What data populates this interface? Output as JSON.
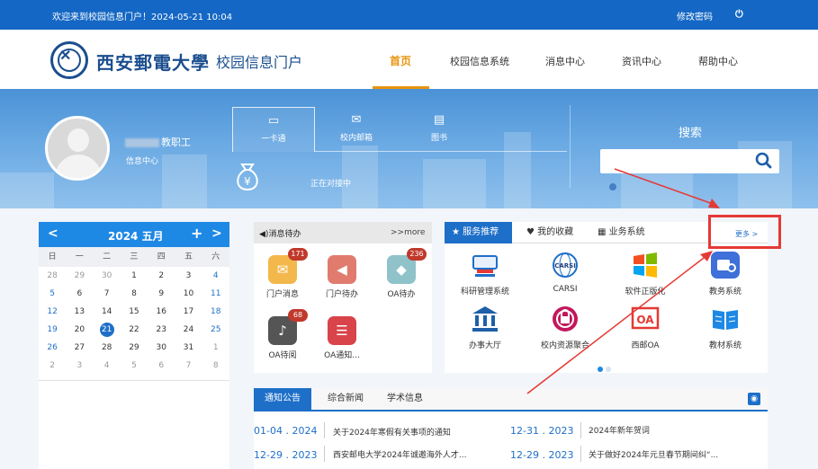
{
  "topbar": {
    "welcome": "欢迎来到校园信息门户！2024-05-21 10:04",
    "change_password": "修改密码",
    "logout_icon": "power-icon"
  },
  "header": {
    "school_name": "西安郵電大學",
    "portal_title": "校园信息门户",
    "nav": [
      "首页",
      "校园信息系统",
      "消息中心",
      "资讯中心",
      "帮助中心"
    ],
    "active_nav": "首页"
  },
  "banner": {
    "user_name_suffix": "教职工",
    "user_info": "信息中心",
    "tabs": [
      {
        "label": "一卡通",
        "icon": "card-icon"
      },
      {
        "label": "校内邮箱",
        "icon": "mail-icon"
      },
      {
        "label": "图书",
        "icon": "book-icon"
      }
    ],
    "active_tab": "一卡通",
    "card_status": "正在对接中",
    "search_title": "搜索",
    "search_placeholder": ""
  },
  "calendar": {
    "title": "2024 五月",
    "weekdays": [
      "日",
      "一",
      "二",
      "三",
      "四",
      "五",
      "六"
    ],
    "weeks": [
      [
        "28",
        "29",
        "30",
        "1",
        "2",
        "3",
        "4"
      ],
      [
        "5",
        "6",
        "7",
        "8",
        "9",
        "10",
        "11"
      ],
      [
        "12",
        "13",
        "14",
        "15",
        "16",
        "17",
        "18"
      ],
      [
        "19",
        "20",
        "21",
        "22",
        "23",
        "24",
        "25"
      ],
      [
        "26",
        "27",
        "28",
        "29",
        "30",
        "31",
        "1"
      ],
      [
        "2",
        "3",
        "4",
        "5",
        "6",
        "7",
        "8"
      ]
    ],
    "today": "21"
  },
  "messages": {
    "title": "消息待办",
    "more": ">>more",
    "apps": [
      {
        "label": "门户消息",
        "badge": "171",
        "color": "#f2b84b",
        "icon": "chat-icon"
      },
      {
        "label": "门户待办",
        "badge": "",
        "color": "#e07b6e",
        "icon": "speaker-icon"
      },
      {
        "label": "OA待办",
        "badge": "236",
        "color": "#8fc3c9",
        "icon": "tag-icon"
      },
      {
        "label": "OA待阅",
        "badge": "68",
        "color": "#555555",
        "icon": "bell-icon"
      },
      {
        "label": "OA通知...",
        "badge": "",
        "color": "#d9434a",
        "icon": "notice-icon"
      }
    ]
  },
  "services": {
    "tabs": [
      "服务推荐",
      "我的收藏",
      "业务系统"
    ],
    "active_tab": "服务推荐",
    "more": "更多 >",
    "items": [
      {
        "label": "科研管理系统",
        "icon": "research-icon"
      },
      {
        "label": "CARSI",
        "icon": "carsi-icon"
      },
      {
        "label": "软件正版化",
        "icon": "windows-icon"
      },
      {
        "label": "教务系统",
        "icon": "edu-icon"
      },
      {
        "label": "办事大厅",
        "icon": "hall-icon"
      },
      {
        "label": "校内资源聚合",
        "icon": "resource-icon"
      },
      {
        "label": "西邮OA",
        "icon": "oa-icon"
      },
      {
        "label": "教材系统",
        "icon": "textbook-icon"
      }
    ],
    "page_count": 2,
    "current_page": 1
  },
  "news": {
    "tabs": [
      "通知公告",
      "综合新闻",
      "学术信息"
    ],
    "active_tab": "通知公告",
    "items": [
      {
        "date": "01-04 . 2024",
        "title": "关于2024年寒假有关事项的通知"
      },
      {
        "date": "12-31 . 2023",
        "title": "2024年新年贺词"
      },
      {
        "date": "12-29 . 2023",
        "title": "西安邮电大学2024年诚邀海外人才..."
      },
      {
        "date": "12-29 . 2023",
        "title": "关于做好2024年元旦春节期间纠“..."
      }
    ]
  },
  "colors": {
    "primary": "#1467c4",
    "accent": "#e8940e",
    "highlight": "#e53935"
  }
}
